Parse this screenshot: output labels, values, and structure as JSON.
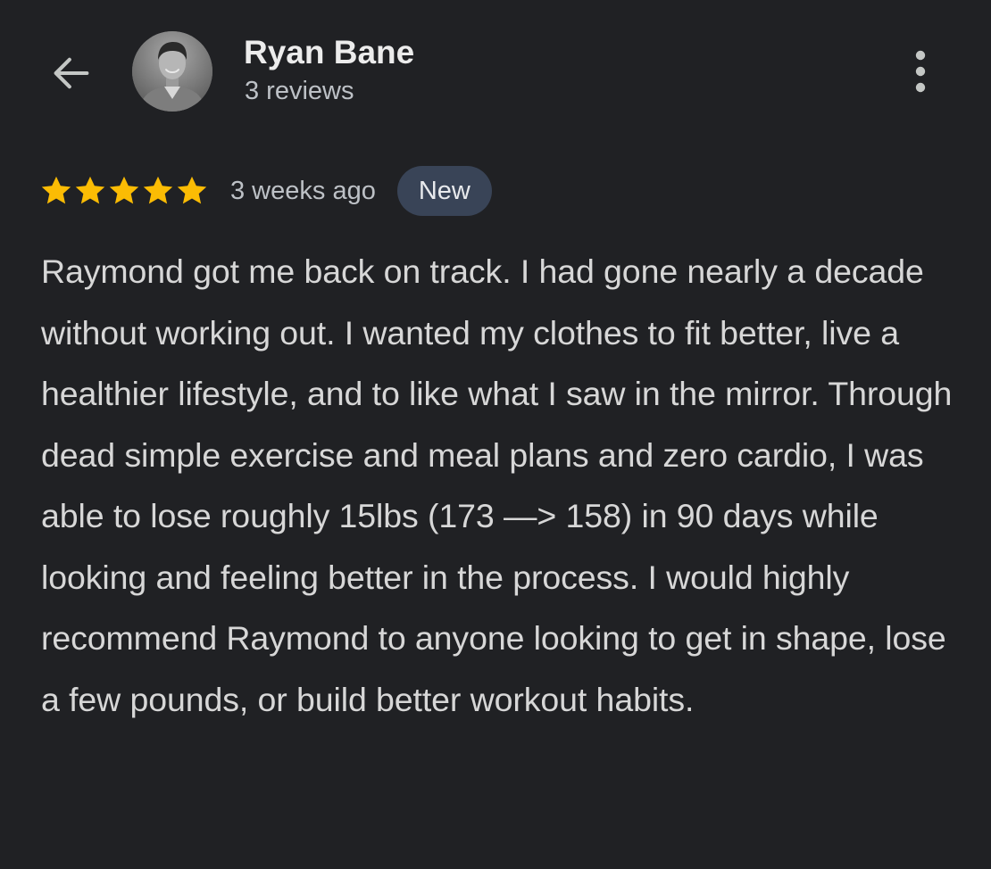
{
  "header": {
    "back_icon": "arrow-left-icon",
    "avatar_icon": "user-avatar-photo",
    "user_name": "Ryan Bane",
    "review_count": "3 reviews",
    "more_icon": "more-vertical-icon"
  },
  "rating": {
    "stars": 5,
    "max_stars": 5,
    "star_color": "#fbbc04",
    "time_ago": "3 weeks ago",
    "badge": "New"
  },
  "review": {
    "text": "Raymond got me back on track. I had gone nearly a decade without working out. I wanted my clothes to fit better, live a healthier lifestyle, and to like what I saw in the mirror. Through dead simple exercise and meal plans and zero cardio, I was able to lose roughly 15lbs (173 —> 158) in 90 days while looking and feeling better in the process. I would highly recommend Raymond to anyone looking to get in shape, lose a few pounds, or build better workout habits."
  },
  "colors": {
    "background": "#202124",
    "text_primary": "#e3e3e3",
    "text_secondary": "#bdc1c6",
    "badge_background": "#394457"
  }
}
